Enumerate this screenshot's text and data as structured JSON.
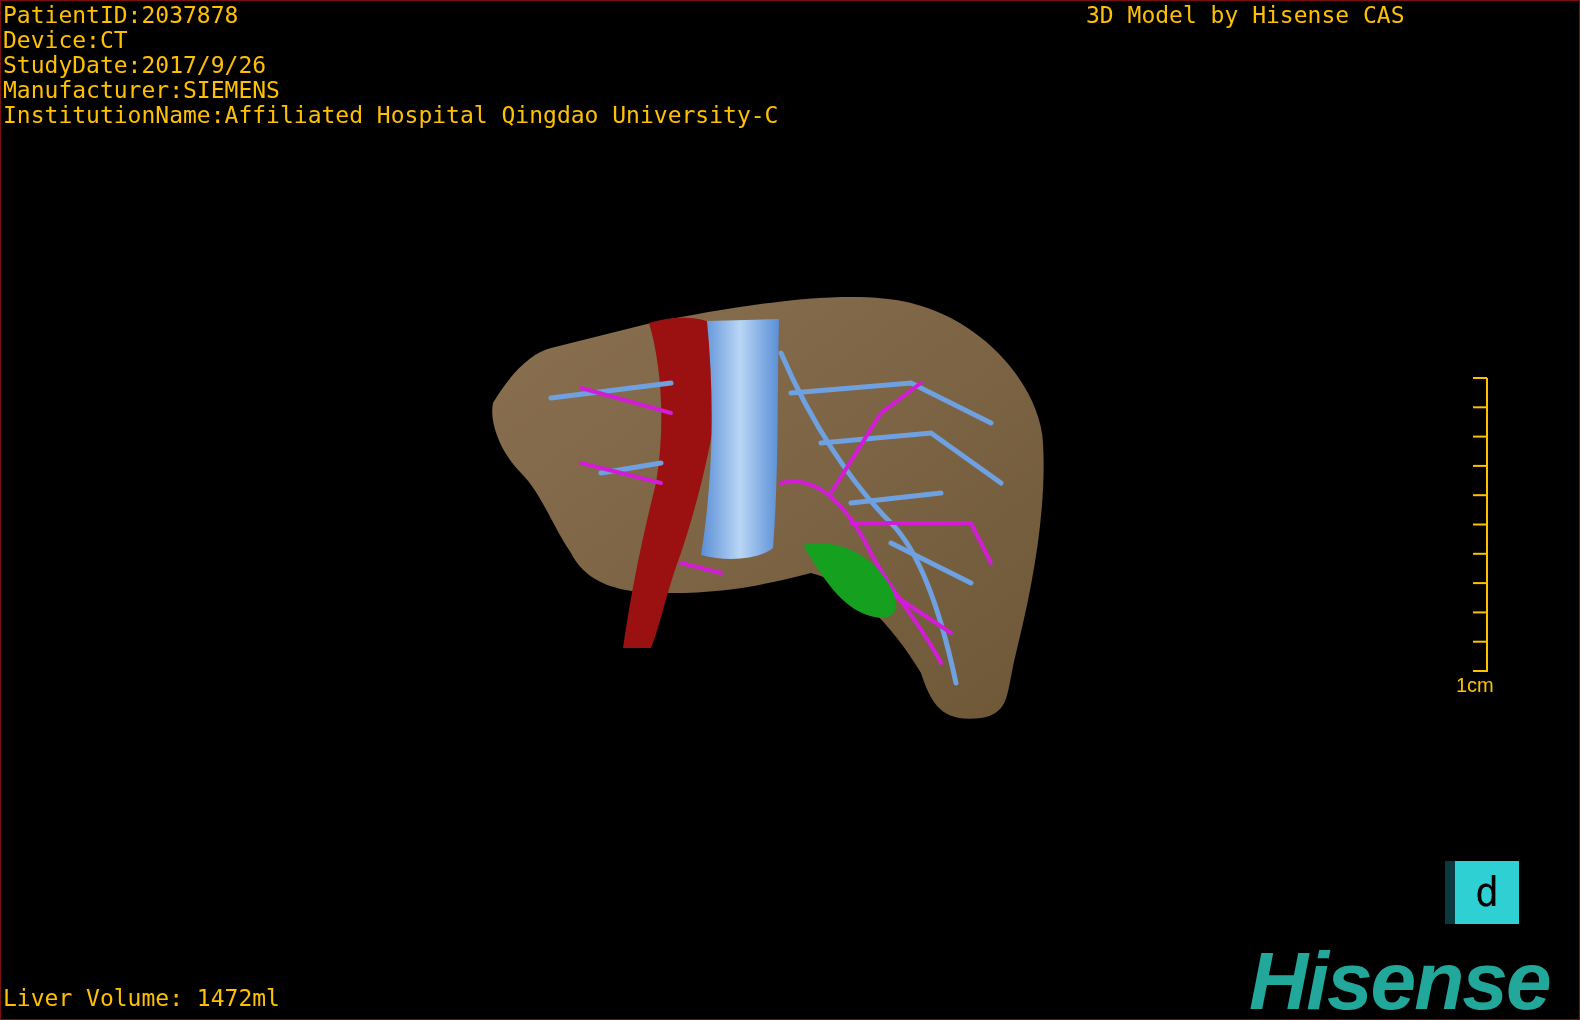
{
  "info_lines": [
    "PatientID:2037878",
    "Device:CT",
    "StudyDate:2017/9/26",
    "Manufacturer:SIEMENS",
    "InstitutionName:Affiliated Hospital Qingdao University-C"
  ],
  "credit": "3D Model by Hisense CAS",
  "scale_bar": {
    "label": "1cm"
  },
  "orientation_cube": {
    "face_letter": "d"
  },
  "logo": "Hisense",
  "liver_volume": "Liver Volume: 1472ml"
}
